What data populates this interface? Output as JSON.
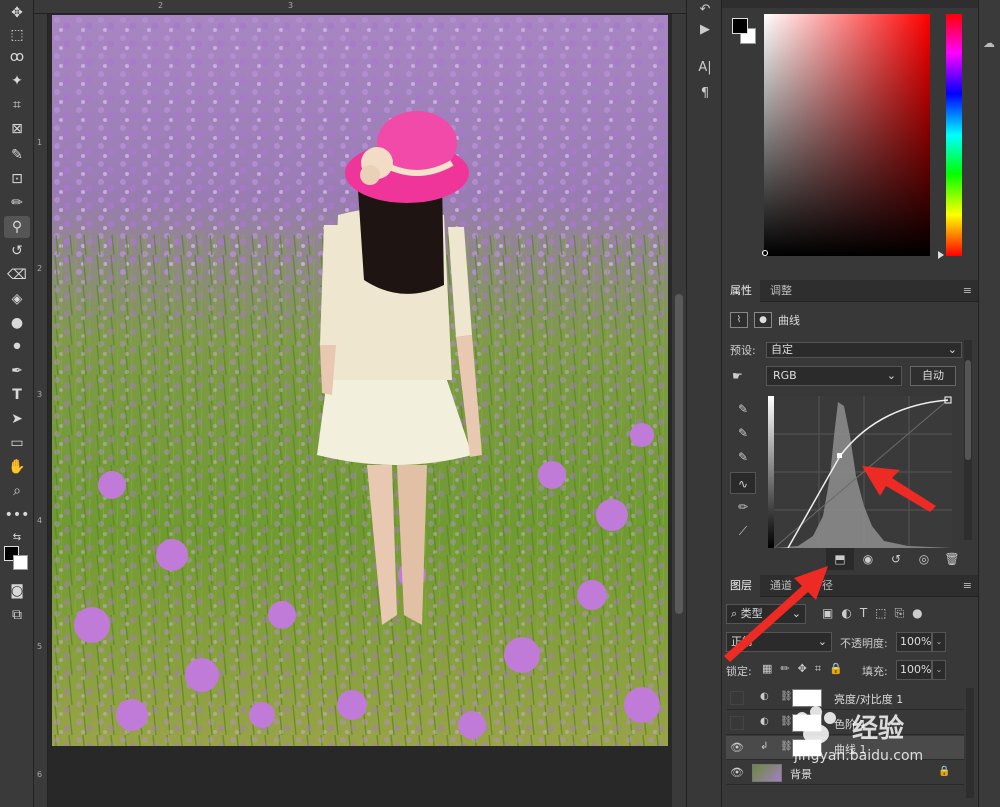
{
  "toolbar": {
    "tools": [
      "move-tool",
      "marquee-tool",
      "lasso-tool",
      "magic-wand-tool",
      "crop-tool",
      "frame-tool",
      "eyedropper-tool",
      "healing-brush-tool",
      "brush-tool",
      "clone-stamp-tool",
      "history-brush-tool",
      "eraser-tool",
      "paint-bucket-tool",
      "blur-tool",
      "dodge-tool",
      "pen-tool",
      "type-tool",
      "path-selection-tool",
      "rectangle-tool",
      "hand-tool",
      "zoom-tool",
      "more-tools"
    ],
    "active_tool": "clone-stamp-tool"
  },
  "rulers": {
    "top_ticks": [
      "2",
      "3"
    ],
    "left_ticks": [
      "1",
      "2",
      "3",
      "4",
      "5",
      "6"
    ]
  },
  "properties": {
    "tab_properties": "属性",
    "tab_adjustments": "调整",
    "title": "曲线",
    "preset_label": "预设:",
    "preset_value": "自定",
    "channel": "RGB",
    "auto_button": "自动"
  },
  "layers_panel": {
    "tab_layers": "图层",
    "tab_channels": "通道",
    "tab_paths": "径",
    "filter_kind": "类型",
    "blend_mode": "正常",
    "opacity_label": "不透明度:",
    "opacity_value": "100%",
    "lock_label": "锁定:",
    "fill_label": "填充:",
    "fill_value": "100%",
    "layers": [
      {
        "name": "亮度/对比度 1",
        "visible": false,
        "type": "adjustment"
      },
      {
        "name": "色阶 1",
        "visible": false,
        "type": "adjustment"
      },
      {
        "name": "曲线 1",
        "visible": true,
        "type": "adjustment",
        "selected": true
      },
      {
        "name": "背景",
        "visible": true,
        "type": "image",
        "locked": true
      }
    ]
  },
  "colors": {
    "accent_arrow": "#ee2a24",
    "panel_bg": "#383838",
    "canvas_bg": "#282828"
  },
  "watermark": {
    "brand": "经验",
    "url": "jingyan.baidu.com"
  }
}
